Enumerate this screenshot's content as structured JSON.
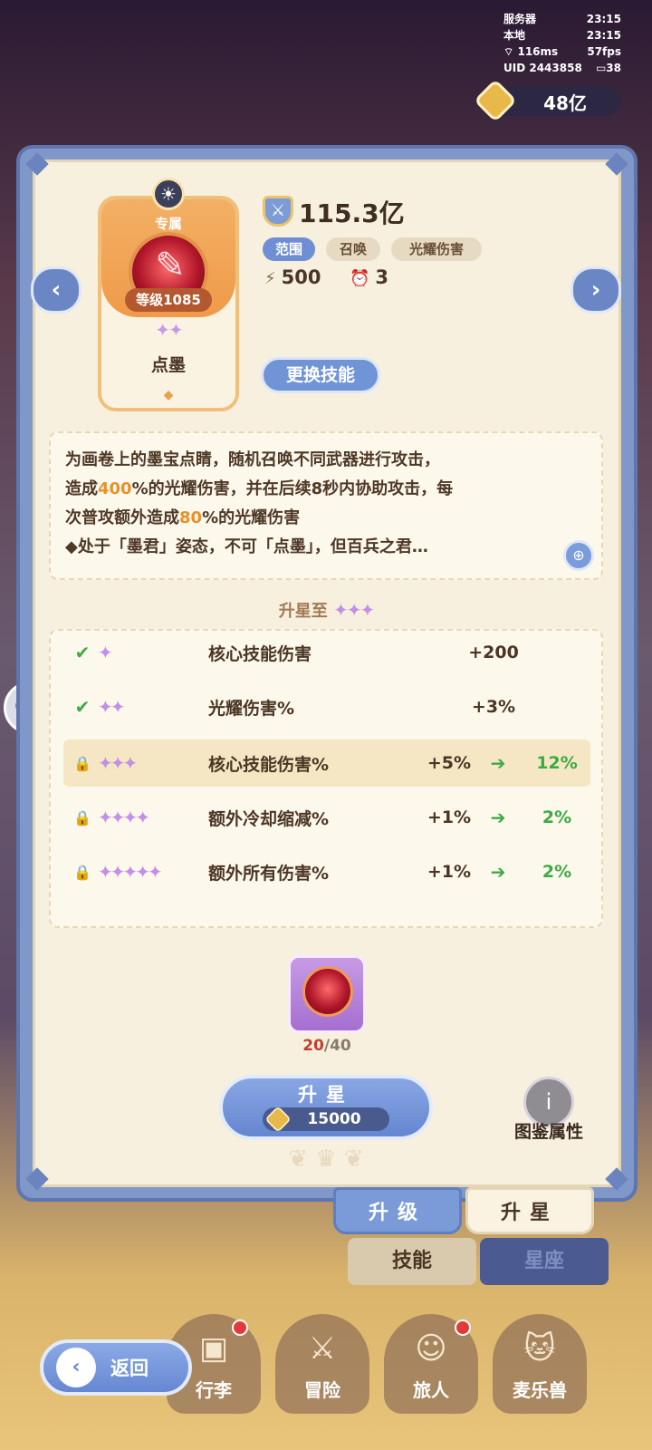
{
  "status": {
    "server_label": "服务器",
    "server_time": "23:15",
    "local_label": "本地",
    "local_time": "23:15",
    "ping": "116ms",
    "fps": "57fps",
    "uid": "UID 2443858",
    "battery": "38"
  },
  "currency": {
    "amount": "48亿",
    "icon": "gold-coin-icon"
  },
  "skill": {
    "exclusive_label": "专属",
    "level": "等级1085",
    "stars": "✦✦",
    "name": "点墨",
    "power": "115.3亿",
    "tags": [
      "范围",
      "召唤",
      "光耀伤害"
    ],
    "energy": "500",
    "cooldown": "3",
    "change_label": "更换技能"
  },
  "description": {
    "line1": "为画卷上的墨宝点睛，随机召唤不同武器进行攻击，",
    "line2_pre": "造成",
    "line2_hl": "400",
    "line2_post": "%的光耀伤害，并在后续8秒内协助攻击，每",
    "line3_pre": "次普攻额外造成",
    "line3_hl": "80",
    "line3_post": "%的光耀伤害",
    "line4": "◆处于「墨君」姿态，不可「点墨」，但百兵之君…"
  },
  "upgrade_to": {
    "label": "升星至",
    "stars": "✦✦✦"
  },
  "star_table": [
    {
      "status": "done",
      "stars": "✦",
      "label": "核心技能伤害",
      "value": "+200"
    },
    {
      "status": "done",
      "stars": "✦✦",
      "label": "光耀伤害%",
      "value": "+3%"
    },
    {
      "status": "locked",
      "stars": "✦✦✦",
      "label": "核心技能伤害%",
      "before": "+5%",
      "after": "12%",
      "highlight": true
    },
    {
      "status": "locked",
      "stars": "✦✦✦✦",
      "label": "额外冷却缩减%",
      "before": "+1%",
      "after": "2%"
    },
    {
      "status": "locked",
      "stars": "✦✦✦✦✦",
      "label": "额外所有伤害%",
      "before": "+1%",
      "after": "2%"
    }
  ],
  "material": {
    "current": "20",
    "total": "/40"
  },
  "star_button": {
    "label": "升星",
    "cost": "15000"
  },
  "codex": {
    "label": "图鉴属性"
  },
  "tabs": {
    "upgrade": "升级",
    "star": "升星",
    "skill": "技能",
    "zodiac": "星座"
  },
  "bottom_nav": [
    "行李",
    "冒险",
    "旅人",
    "麦乐兽"
  ],
  "back": {
    "label": "返回"
  },
  "colors": {
    "accent": "#7194d6",
    "highlight": "#e6922a",
    "green": "#3eaa45",
    "panel": "#f7f0df"
  }
}
